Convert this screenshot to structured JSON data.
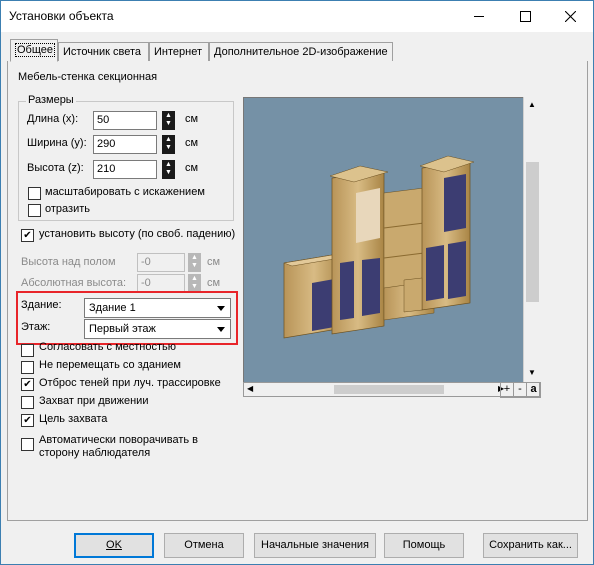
{
  "window": {
    "title": "Установки объекта"
  },
  "caption_buttons": {
    "minimize_icon": "minimize-icon",
    "maximize_icon": "maximize-icon",
    "close_icon": "close-icon"
  },
  "tabs": [
    {
      "label": "Общее",
      "active": true
    },
    {
      "label": "Источник света"
    },
    {
      "label": "Интернет"
    },
    {
      "label": "Дополнительное 2D-изображение"
    }
  ],
  "object_name": "Мебель-стенка секционная",
  "sizes": {
    "legend": "Размеры",
    "length": {
      "label": "Длина (x):",
      "value": "50",
      "unit": "см"
    },
    "width": {
      "label": "Ширина (y):",
      "value": "290",
      "unit": "см"
    },
    "height": {
      "label": "Высота (z):",
      "value": "210",
      "unit": "см"
    },
    "scale_distort": {
      "label": "масштабировать с искажением",
      "checked": false
    },
    "mirror": {
      "label": "отразить",
      "checked": false
    }
  },
  "set_height": {
    "label": "установить высоту (по своб. падению)",
    "checked": true
  },
  "height_above_floor": {
    "label": "Высота над полом",
    "value": "-0",
    "unit": "см"
  },
  "absolute_height": {
    "label": "Абсолютная высота:",
    "value": "-0",
    "unit": "см"
  },
  "building": {
    "label": "Здание:",
    "value": "Здание 1"
  },
  "floor": {
    "label": "Этаж:",
    "value": "Первый этаж"
  },
  "options": [
    {
      "label": "Согласовать с местностью",
      "checked": false
    },
    {
      "label": "Не перемещать со зданием",
      "checked": false
    },
    {
      "label": "Отброс теней при луч. трассировке",
      "checked": true
    },
    {
      "label": "Захват при движении",
      "checked": false
    },
    {
      "label": "Цель захвата",
      "checked": true
    }
  ],
  "auto_rotate": {
    "label_line1": "Автоматически поворачивать в",
    "label_line2": "сторону наблюдателя",
    "checked": false
  },
  "preview_controls": {
    "plus": "+",
    "minus": "-",
    "a": "a"
  },
  "buttons": {
    "ok": "OK",
    "cancel": "Отмена",
    "defaults": "Начальные значения",
    "help": "Помощь",
    "save_as": "Сохранить как..."
  },
  "colors": {
    "preview_bg": "#7591a6",
    "highlight": "#e8252a",
    "default_button_border": "#0078d7"
  }
}
